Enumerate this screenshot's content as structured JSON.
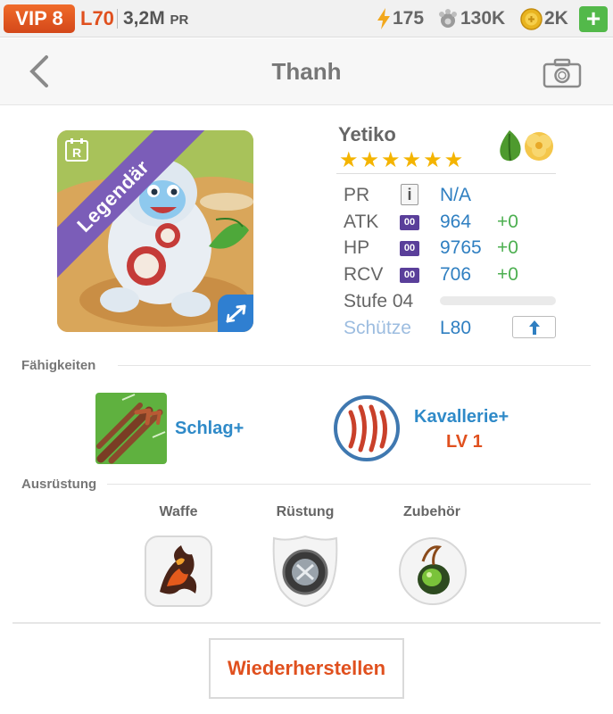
{
  "status_bar": {
    "vip": "VIP 8",
    "level": "L70",
    "power": "3,2M",
    "power_unit": "PR",
    "energy": "175",
    "food": "130K",
    "gold": "2K",
    "plus_label": "+"
  },
  "header": {
    "title": "Thanh"
  },
  "hero": {
    "name": "Yetiko",
    "rarity": "Legendär",
    "stars": "★★★★★★",
    "star_count": 6,
    "stats": [
      {
        "label": "PR",
        "value": "N/A",
        "bonus": "",
        "icon": "info-icon"
      },
      {
        "label": "ATK",
        "value": "964",
        "bonus": "+0",
        "badge": "00"
      },
      {
        "label": "HP",
        "value": "9765",
        "bonus": "+0",
        "badge": "00"
      },
      {
        "label": "RCV",
        "value": "706",
        "bonus": "+0",
        "badge": "00"
      }
    ],
    "stage_label": "Stufe 04",
    "stage_progress": 0,
    "class_label": "Schütze",
    "class_level": "L80",
    "info_glyph": "i"
  },
  "skills": {
    "section_label": "Fähigkeiten",
    "items": [
      {
        "name": "Schlag+",
        "level": ""
      },
      {
        "name": "Kavallerie+",
        "level": "LV 1"
      }
    ]
  },
  "equipment": {
    "section_label": "Ausrüstung",
    "slots": [
      {
        "label": "Waffe",
        "icon": "weapon-icon"
      },
      {
        "label": "Rüstung",
        "icon": "armor-icon"
      },
      {
        "label": "Zubehör",
        "icon": "accessory-icon"
      }
    ]
  },
  "actions": {
    "restore_label": "Wiederherstellen"
  },
  "colors": {
    "accent_orange": "#e0501e",
    "value_blue": "#2f7fc1",
    "bonus_green": "#4caf50",
    "legendary_purple": "#7b5db8"
  }
}
